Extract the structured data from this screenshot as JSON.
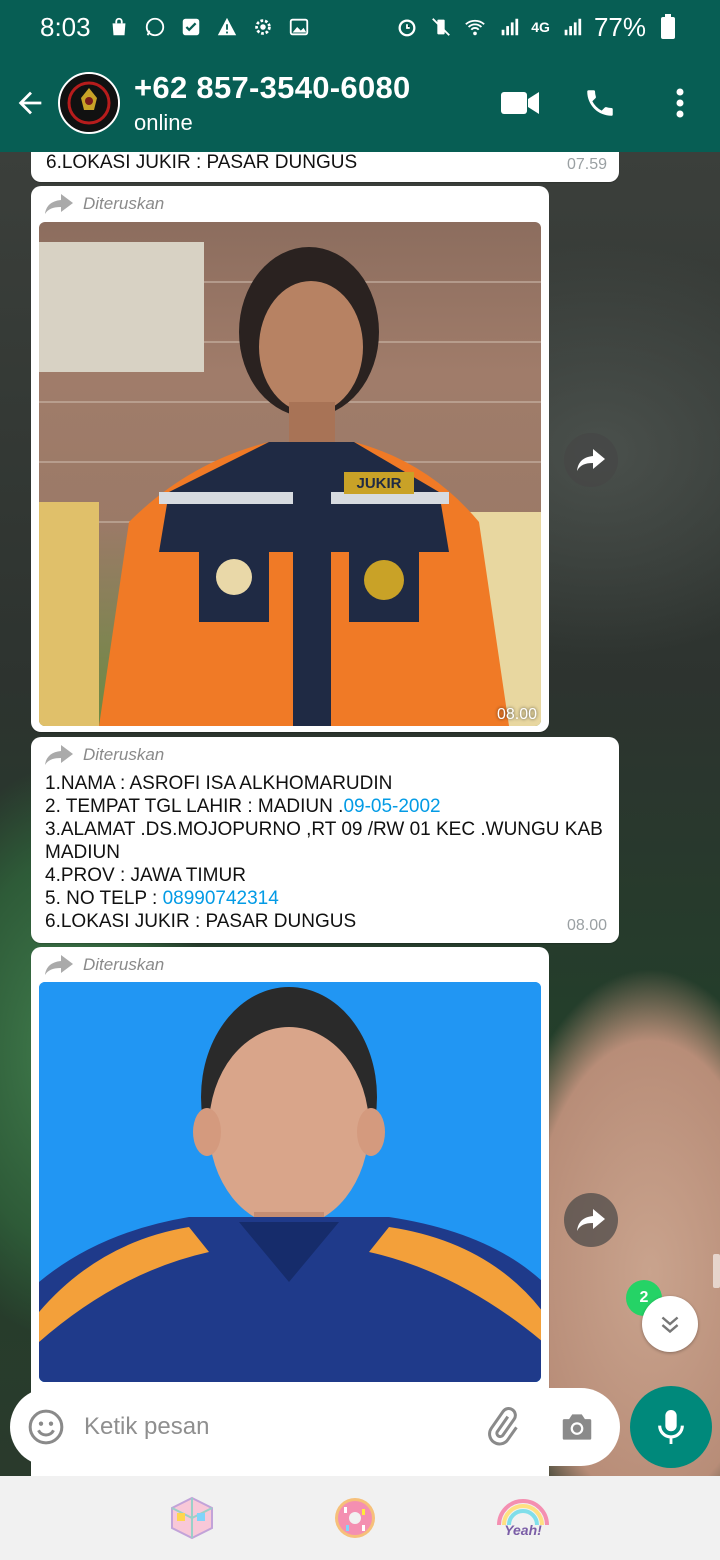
{
  "status_bar": {
    "time": "8:03",
    "network": "4G",
    "battery": "77%"
  },
  "header": {
    "title": "+62 857-3540-6080",
    "subtitle": "online"
  },
  "messages": [
    {
      "type": "text-partial",
      "lines": [
        "6.LOKASI JUKIR : PASAR DUNGUS"
      ],
      "time": "07.59"
    },
    {
      "type": "image",
      "forwarded_label": "Diteruskan",
      "time": "08.00",
      "photo_badge": "JUKIR"
    },
    {
      "type": "text",
      "forwarded_label": "Diteruskan",
      "line1": "1.NAMA : ASROFI ISA ALKHOMARUDIN",
      "line2_prefix": "2. TEMPAT TGL LAHIR : MADIUN .",
      "line2_link": "09-05-2002",
      "line3": "3.ALAMAT .DS.MOJOPURNO ,RT 09 /RW 01 KEC .WUNGU  KAB MADIUN",
      "line4": "4.PROV : JAWA TIMUR",
      "line5_prefix": "5. NO TELP : ",
      "line5_link": "08990742314",
      "line6": "6.LOKASI JUKIR : PASAR DUNGUS",
      "time": "08.00"
    },
    {
      "type": "image",
      "forwarded_label": "Diteruskan"
    }
  ],
  "scroll": {
    "unread_count": "2"
  },
  "input": {
    "placeholder": "Ketik pesan"
  },
  "stickers": [
    "rubik-cube-sticker",
    "donut-sticker",
    "yeah-rainbow-sticker"
  ],
  "sticker_yeah_text": "Yeah!",
  "colors": {
    "header": "#075e54",
    "mic": "#00897b",
    "badge": "#25d366",
    "link": "#039be5"
  }
}
